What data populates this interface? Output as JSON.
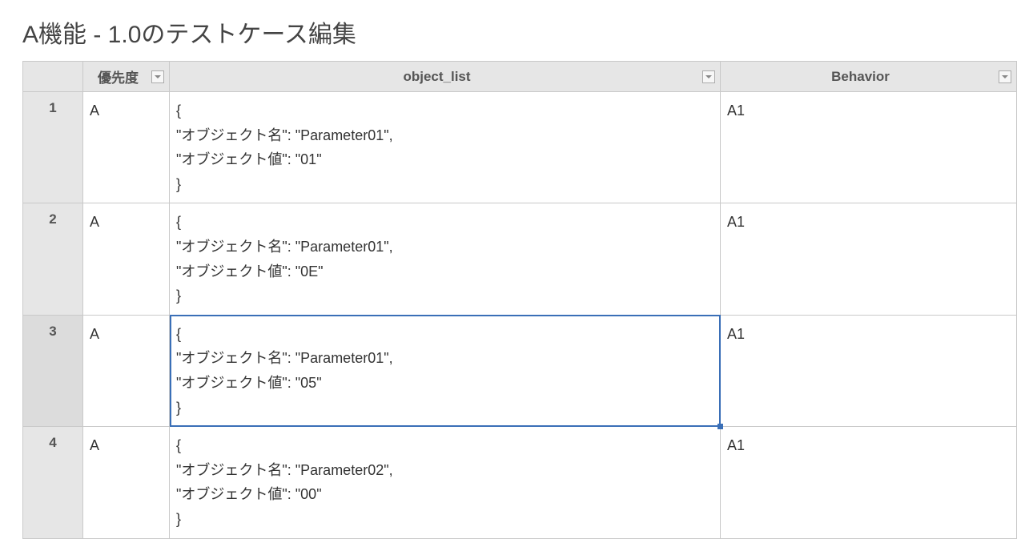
{
  "page": {
    "title": "A機能 - 1.0のテストケース編集"
  },
  "columns": {
    "priority": "優先度",
    "object_list": "object_list",
    "behavior": "Behavior"
  },
  "rows": [
    {
      "num": "1",
      "priority": "A",
      "object_list": "{\n\"オブジェクト名\": \"Parameter01\",\n\"オブジェクト値\": \"01\"\n}",
      "behavior": "A1"
    },
    {
      "num": "2",
      "priority": "A",
      "object_list": "{\n\"オブジェクト名\": \"Parameter01\",\n\"オブジェクト値\": \"0E\"\n}",
      "behavior": "A1"
    },
    {
      "num": "3",
      "selected": true,
      "priority": "A",
      "object_list": "{\n\"オブジェクト名\": \"Parameter01\",\n\"オブジェクト値\": \"05\"\n}",
      "behavior": "A1"
    },
    {
      "num": "4",
      "priority": "A",
      "object_list": "{\n\"オブジェクト名\": \"Parameter02\",\n\"オブジェクト値\": \"00\"\n}",
      "behavior": "A1"
    }
  ]
}
